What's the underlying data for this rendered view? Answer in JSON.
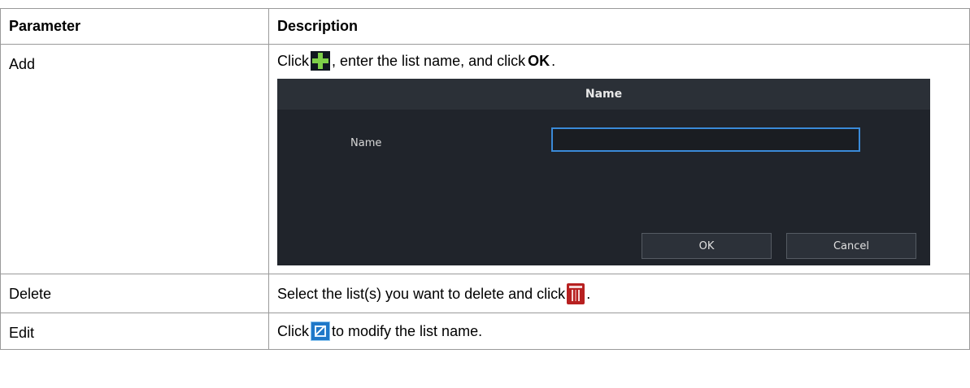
{
  "table": {
    "headers": {
      "parameter": "Parameter",
      "description": "Description"
    },
    "rows": {
      "add": {
        "parameter": "Add",
        "text_before": "Click",
        "text_after": ", enter the list name, and click",
        "bold": "OK",
        "text_end": ".",
        "icon": "add-plus-icon"
      },
      "delete": {
        "parameter": "Delete",
        "text_before": "Select the list(s) you want to delete and click",
        "text_end": ".",
        "icon": "delete-trash-icon"
      },
      "edit": {
        "parameter": "Edit",
        "text_before": "Click",
        "text_after": "to modify the list name.",
        "icon": "edit-icon"
      }
    }
  },
  "dialog": {
    "title": "Name",
    "field_label": "Name",
    "field_value": "",
    "ok_label": "OK",
    "cancel_label": "Cancel",
    "colors": {
      "background": "#20242b",
      "title_bar": "#2b3037",
      "input_border": "#3a8ad8"
    }
  }
}
